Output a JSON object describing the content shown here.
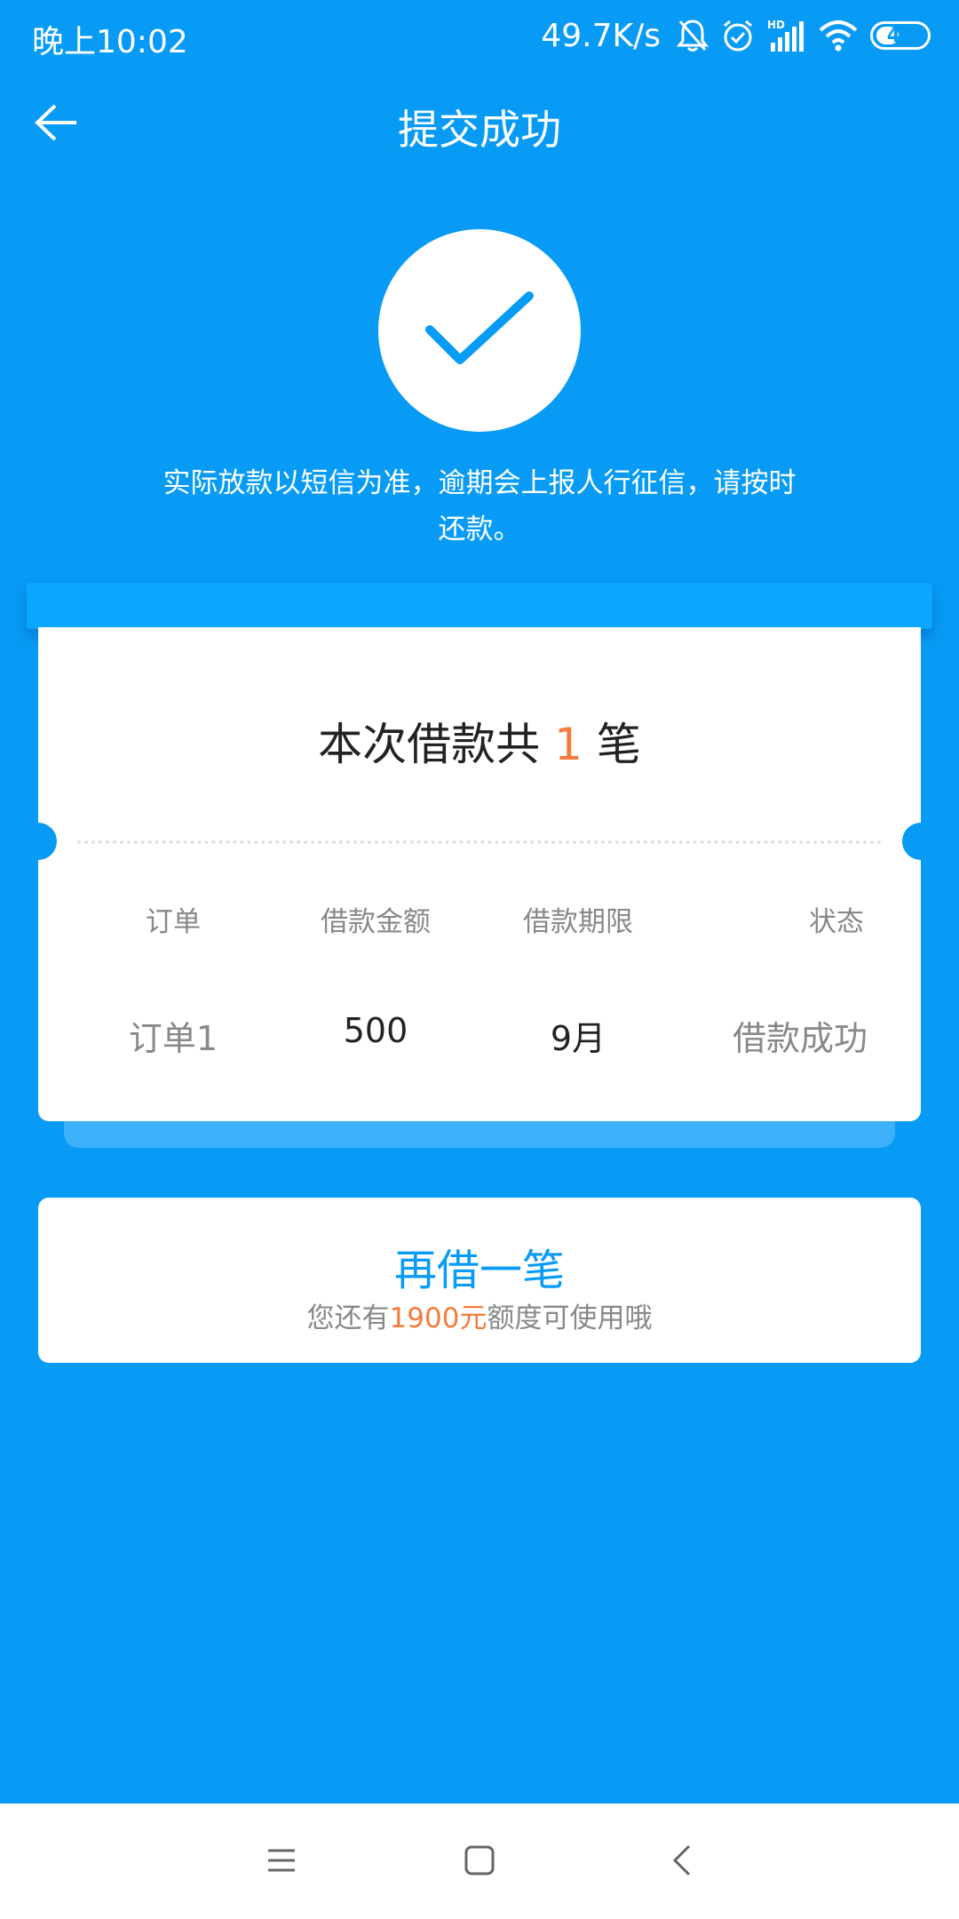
{
  "status_bar": {
    "time": "晚上10:02",
    "network_speed": "49.7K/s",
    "battery_level": "41",
    "icons": [
      "mute-bell-icon",
      "alarm-icon",
      "hd-signal-icon",
      "wifi-icon",
      "battery-icon"
    ]
  },
  "header": {
    "title": "提交成功",
    "back_icon": "arrow-left-icon"
  },
  "success": {
    "icon": "checkmark-icon",
    "notice_line1": "实际放款以短信为准，逾期会上报人行征信，请按时",
    "notice_line2": "还款。"
  },
  "loan_summary": {
    "prefix": "本次借款共",
    "count": "1",
    "suffix": "笔",
    "columns": [
      "订单",
      "借款金额",
      "借款期限",
      "状态"
    ],
    "rows": [
      {
        "order": "订单1",
        "amount": "500",
        "term": "9月",
        "status": "借款成功"
      }
    ]
  },
  "borrow_again": {
    "title": "再借一笔",
    "sub_prefix": "您还有",
    "sub_amount": "1900元",
    "sub_suffix": "额度可使用哦"
  },
  "nav_bar": {
    "icons": [
      "menu-icon",
      "home-icon",
      "back-icon"
    ]
  },
  "colors": {
    "background": "#079BF5",
    "accent_orange": "#F47B3B",
    "card": "#FFFFFF"
  }
}
